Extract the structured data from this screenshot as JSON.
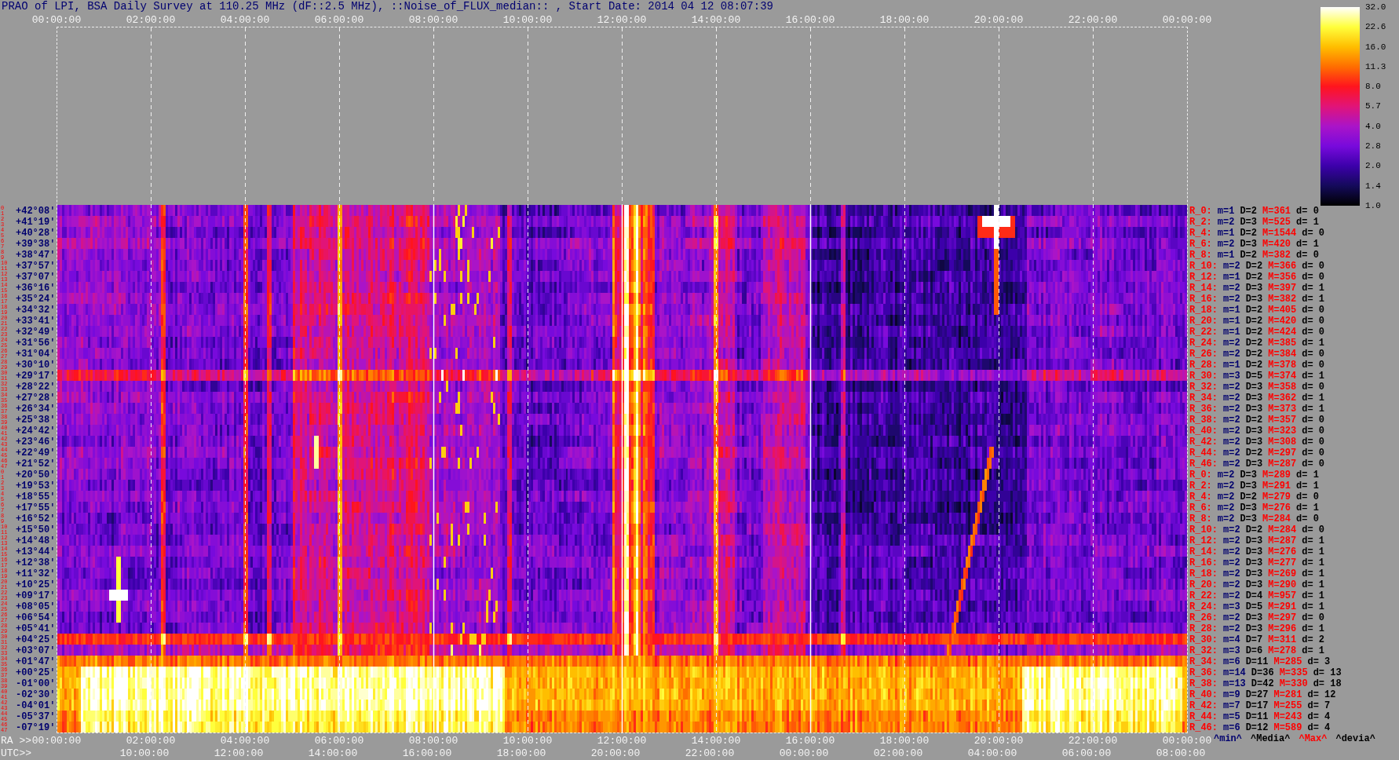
{
  "title": "PRAO of LPI, BSA Daily Survey at 110.25 MHz (dF::2.5 MHz), ::Noise_of_FLUX_median:: , Start Date: 2014 04 12 08:07:39",
  "top_axis": {
    "labels": [
      "00:00:00",
      "02:00:00",
      "04:00:00",
      "06:00:00",
      "08:00:00",
      "10:00:00",
      "12:00:00",
      "14:00:00",
      "16:00:00",
      "18:00:00",
      "20:00:00",
      "22:00:00",
      "00:00:00"
    ]
  },
  "colorbar": {
    "ticks": [
      "32.0",
      "22.6",
      "16.0",
      "11.3",
      "8.0",
      "5.7",
      "4.0",
      "2.8",
      "2.0",
      "1.4",
      "1.0"
    ]
  },
  "rows": [
    {
      "numbers": [
        "0",
        "1"
      ],
      "declination": "+42°08'",
      "stats": {
        "label": "R_0:",
        "min": "m=1",
        "median": "D=2",
        "max": "M=361",
        "deviation": "d= 0"
      }
    },
    {
      "numbers": [
        "2",
        "3"
      ],
      "declination": "+41°19'",
      "stats": {
        "label": "R_2:",
        "min": "m=2",
        "median": "D=3",
        "max": "M=525",
        "deviation": "d= 1"
      }
    },
    {
      "numbers": [
        "4",
        "5"
      ],
      "declination": "+40°28'",
      "stats": {
        "label": "R_4:",
        "min": "m=1",
        "median": "D=2",
        "max": "M=1544",
        "deviation": "d= 0"
      }
    },
    {
      "numbers": [
        "6",
        "7"
      ],
      "declination": "+39°38'",
      "stats": {
        "label": "R_6:",
        "min": "m=2",
        "median": "D=3",
        "max": "M=420",
        "deviation": "d= 1"
      }
    },
    {
      "numbers": [
        "8",
        "9"
      ],
      "declination": "+38°47'",
      "stats": {
        "label": "R_8:",
        "min": "m=1",
        "median": "D=2",
        "max": "M=382",
        "deviation": "d= 0"
      }
    },
    {
      "numbers": [
        "10",
        "11"
      ],
      "declination": "+37°57'",
      "stats": {
        "label": "R_10:",
        "min": "m=2",
        "median": "D=2",
        "max": "M=366",
        "deviation": "d= 0"
      }
    },
    {
      "numbers": [
        "12",
        "13"
      ],
      "declination": "+37°07'",
      "stats": {
        "label": "R_12:",
        "min": "m=1",
        "median": "D=2",
        "max": "M=356",
        "deviation": "d= 0"
      }
    },
    {
      "numbers": [
        "14",
        "15"
      ],
      "declination": "+36°16'",
      "stats": {
        "label": "R_14:",
        "min": "m=2",
        "median": "D=3",
        "max": "M=397",
        "deviation": "d= 1"
      }
    },
    {
      "numbers": [
        "16",
        "17"
      ],
      "declination": "+35°24'",
      "stats": {
        "label": "R_16:",
        "min": "m=2",
        "median": "D=3",
        "max": "M=382",
        "deviation": "d= 1"
      }
    },
    {
      "numbers": [
        "18",
        "19"
      ],
      "declination": "+34°32'",
      "stats": {
        "label": "R_18:",
        "min": "m=1",
        "median": "D=2",
        "max": "M=405",
        "deviation": "d= 0"
      }
    },
    {
      "numbers": [
        "20",
        "21"
      ],
      "declination": "+33°41'",
      "stats": {
        "label": "R_20:",
        "min": "m=1",
        "median": "D=2",
        "max": "M=420",
        "deviation": "d= 0"
      }
    },
    {
      "numbers": [
        "22",
        "23"
      ],
      "declination": "+32°49'",
      "stats": {
        "label": "R_22:",
        "min": "m=1",
        "median": "D=2",
        "max": "M=424",
        "deviation": "d= 0"
      }
    },
    {
      "numbers": [
        "24",
        "25"
      ],
      "declination": "+31°56'",
      "stats": {
        "label": "R_24:",
        "min": "m=2",
        "median": "D=2",
        "max": "M=385",
        "deviation": "d= 1"
      }
    },
    {
      "numbers": [
        "26",
        "27"
      ],
      "declination": "+31°04'",
      "stats": {
        "label": "R_26:",
        "min": "m=2",
        "median": "D=2",
        "max": "M=384",
        "deviation": "d= 0"
      }
    },
    {
      "numbers": [
        "28",
        "29"
      ],
      "declination": "+30°10'",
      "stats": {
        "label": "R_28:",
        "min": "m=1",
        "median": "D=2",
        "max": "M=378",
        "deviation": "d= 0"
      }
    },
    {
      "numbers": [
        "30",
        "31"
      ],
      "declination": "+29°17'",
      "stats": {
        "label": "R_30:",
        "min": "m=3",
        "median": "D=5",
        "max": "M=374",
        "deviation": "d= 1"
      }
    },
    {
      "numbers": [
        "32",
        "33"
      ],
      "declination": "+28°22'",
      "stats": {
        "label": "R_32:",
        "min": "m=2",
        "median": "D=3",
        "max": "M=358",
        "deviation": "d= 0"
      }
    },
    {
      "numbers": [
        "34",
        "35"
      ],
      "declination": "+27°28'",
      "stats": {
        "label": "R_34:",
        "min": "m=2",
        "median": "D=3",
        "max": "M=362",
        "deviation": "d= 1"
      }
    },
    {
      "numbers": [
        "36",
        "37"
      ],
      "declination": "+26°34'",
      "stats": {
        "label": "R_36:",
        "min": "m=2",
        "median": "D=3",
        "max": "M=373",
        "deviation": "d= 1"
      }
    },
    {
      "numbers": [
        "38",
        "39"
      ],
      "declination": "+25°38'",
      "stats": {
        "label": "R_38:",
        "min": "m=2",
        "median": "D=2",
        "max": "M=357",
        "deviation": "d= 0"
      }
    },
    {
      "numbers": [
        "40",
        "41"
      ],
      "declination": "+24°42'",
      "stats": {
        "label": "R_40:",
        "min": "m=2",
        "median": "D=3",
        "max": "M=323",
        "deviation": "d= 0"
      }
    },
    {
      "numbers": [
        "42",
        "43"
      ],
      "declination": "+23°46'",
      "stats": {
        "label": "R_42:",
        "min": "m=2",
        "median": "D=3",
        "max": "M=308",
        "deviation": "d= 0"
      }
    },
    {
      "numbers": [
        "44",
        "45"
      ],
      "declination": "+22°49'",
      "stats": {
        "label": "R_44:",
        "min": "m=2",
        "median": "D=2",
        "max": "M=297",
        "deviation": "d= 0"
      }
    },
    {
      "numbers": [
        "46",
        "47"
      ],
      "declination": "+21°52'",
      "stats": {
        "label": "R_46:",
        "min": "m=2",
        "median": "D=3",
        "max": "M=287",
        "deviation": "d= 0"
      }
    },
    {
      "numbers": [
        "0",
        "1"
      ],
      "declination": "+20°50'",
      "stats": {
        "label": "R_0:",
        "min": "m=2",
        "median": "D=3",
        "max": "M=289",
        "deviation": "d= 1"
      }
    },
    {
      "numbers": [
        "2",
        "3"
      ],
      "declination": "+19°53'",
      "stats": {
        "label": "R_2:",
        "min": "m=2",
        "median": "D=3",
        "max": "M=291",
        "deviation": "d= 1"
      }
    },
    {
      "numbers": [
        "4",
        "5"
      ],
      "declination": "+18°55'",
      "stats": {
        "label": "R_4:",
        "min": "m=2",
        "median": "D=2",
        "max": "M=279",
        "deviation": "d= 0"
      }
    },
    {
      "numbers": [
        "6",
        "7"
      ],
      "declination": "+17°55'",
      "stats": {
        "label": "R_6:",
        "min": "m=2",
        "median": "D=3",
        "max": "M=276",
        "deviation": "d= 1"
      }
    },
    {
      "numbers": [
        "8",
        "9"
      ],
      "declination": "+16°52'",
      "stats": {
        "label": "R_8:",
        "min": "m=2",
        "median": "D=3",
        "max": "M=284",
        "deviation": "d= 0"
      }
    },
    {
      "numbers": [
        "10",
        "11"
      ],
      "declination": "+15°50'",
      "stats": {
        "label": "R_10:",
        "min": "m=2",
        "median": "D=2",
        "max": "M=284",
        "deviation": "d= 0"
      }
    },
    {
      "numbers": [
        "12",
        "13"
      ],
      "declination": "+14°48'",
      "stats": {
        "label": "R_12:",
        "min": "m=2",
        "median": "D=3",
        "max": "M=287",
        "deviation": "d= 1"
      }
    },
    {
      "numbers": [
        "14",
        "15"
      ],
      "declination": "+13°44'",
      "stats": {
        "label": "R_14:",
        "min": "m=2",
        "median": "D=3",
        "max": "M=276",
        "deviation": "d= 1"
      }
    },
    {
      "numbers": [
        "16",
        "17"
      ],
      "declination": "+12°38'",
      "stats": {
        "label": "R_16:",
        "min": "m=2",
        "median": "D=3",
        "max": "M=277",
        "deviation": "d= 1"
      }
    },
    {
      "numbers": [
        "18",
        "19"
      ],
      "declination": "+11°32'",
      "stats": {
        "label": "R_18:",
        "min": "m=2",
        "median": "D=3",
        "max": "M=269",
        "deviation": "d= 1"
      }
    },
    {
      "numbers": [
        "20",
        "21"
      ],
      "declination": "+10°25'",
      "stats": {
        "label": "R_20:",
        "min": "m=2",
        "median": "D=3",
        "max": "M=290",
        "deviation": "d= 1"
      }
    },
    {
      "numbers": [
        "22",
        "23"
      ],
      "declination": "+09°17'",
      "stats": {
        "label": "R_22:",
        "min": "m=2",
        "median": "D=4",
        "max": "M=957",
        "deviation": "d= 1"
      }
    },
    {
      "numbers": [
        "24",
        "25"
      ],
      "declination": "+08°05'",
      "stats": {
        "label": "R_24:",
        "min": "m=3",
        "median": "D=5",
        "max": "M=291",
        "deviation": "d= 1"
      }
    },
    {
      "numbers": [
        "26",
        "27"
      ],
      "declination": "+06°54'",
      "stats": {
        "label": "R_26:",
        "min": "m=2",
        "median": "D=3",
        "max": "M=297",
        "deviation": "d= 0"
      }
    },
    {
      "numbers": [
        "28",
        "29"
      ],
      "declination": "+05°41'",
      "stats": {
        "label": "R_28:",
        "min": "m=2",
        "median": "D=3",
        "max": "M=296",
        "deviation": "d= 1"
      }
    },
    {
      "numbers": [
        "30",
        "31"
      ],
      "declination": "+04°25'",
      "stats": {
        "label": "R_30:",
        "min": "m=4",
        "median": "D=7",
        "max": "M=311",
        "deviation": "d= 2"
      }
    },
    {
      "numbers": [
        "32",
        "33"
      ],
      "declination": "+03°07'",
      "stats": {
        "label": "R_32:",
        "min": "m=3",
        "median": "D=6",
        "max": "M=278",
        "deviation": "d= 1"
      }
    },
    {
      "numbers": [
        "34",
        "35"
      ],
      "declination": "+01°47'",
      "stats": {
        "label": "R_34:",
        "min": "m=6",
        "median": "D=11",
        "max": "M=285",
        "deviation": "d= 3"
      }
    },
    {
      "numbers": [
        "36",
        "37"
      ],
      "declination": "+00°25'",
      "stats": {
        "label": "R_36:",
        "min": "m=14",
        "median": "D=36",
        "max": "M=335",
        "deviation": "d= 13"
      }
    },
    {
      "numbers": [
        "38",
        "39"
      ],
      "declination": "-01°00'",
      "stats": {
        "label": "R_38:",
        "min": "m=13",
        "median": "D=42",
        "max": "M=330",
        "deviation": "d= 18"
      }
    },
    {
      "numbers": [
        "40",
        "41"
      ],
      "declination": "-02°30'",
      "stats": {
        "label": "R_40:",
        "min": "m=9",
        "median": "D=27",
        "max": "M=281",
        "deviation": "d= 12"
      }
    },
    {
      "numbers": [
        "42",
        "43"
      ],
      "declination": "-04°01'",
      "stats": {
        "label": "R_42:",
        "min": "m=7",
        "median": "D=17",
        "max": "M=255",
        "deviation": "d= 7"
      }
    },
    {
      "numbers": [
        "44",
        "45"
      ],
      "declination": "-05°37'",
      "stats": {
        "label": "R_44:",
        "min": "m=5",
        "median": "D=11",
        "max": "M=243",
        "deviation": "d= 4"
      }
    },
    {
      "numbers": [
        "46",
        "47"
      ],
      "declination": "-07°19'",
      "stats": {
        "label": "R_46:",
        "min": "m=6",
        "median": "D=12",
        "max": "M=589",
        "deviation": "d= 4"
      }
    }
  ],
  "bottom_axis": {
    "ra": {
      "prefix": "RA >>",
      "labels": [
        "00:00:00",
        "02:00:00",
        "04:00:00",
        "06:00:00",
        "08:00:00",
        "10:00:00",
        "12:00:00",
        "14:00:00",
        "16:00:00",
        "18:00:00",
        "20:00:00",
        "22:00:00",
        "00:00:00"
      ]
    },
    "utc": {
      "prefix": "UTC>>",
      "labels": [
        "10:00:00",
        "12:00:00",
        "14:00:00",
        "16:00:00",
        "18:00:00",
        "20:00:00",
        "22:00:00",
        "00:00:00",
        "02:00:00",
        "04:00:00",
        "06:00:00",
        "08:00:00"
      ]
    }
  },
  "legend": [
    {
      "kind": "min",
      "text": "^min^"
    },
    {
      "kind": "median",
      "text": "^Media^"
    },
    {
      "kind": "max",
      "text": "^Max^"
    },
    {
      "kind": "deviation",
      "text": "^devia^"
    }
  ]
}
